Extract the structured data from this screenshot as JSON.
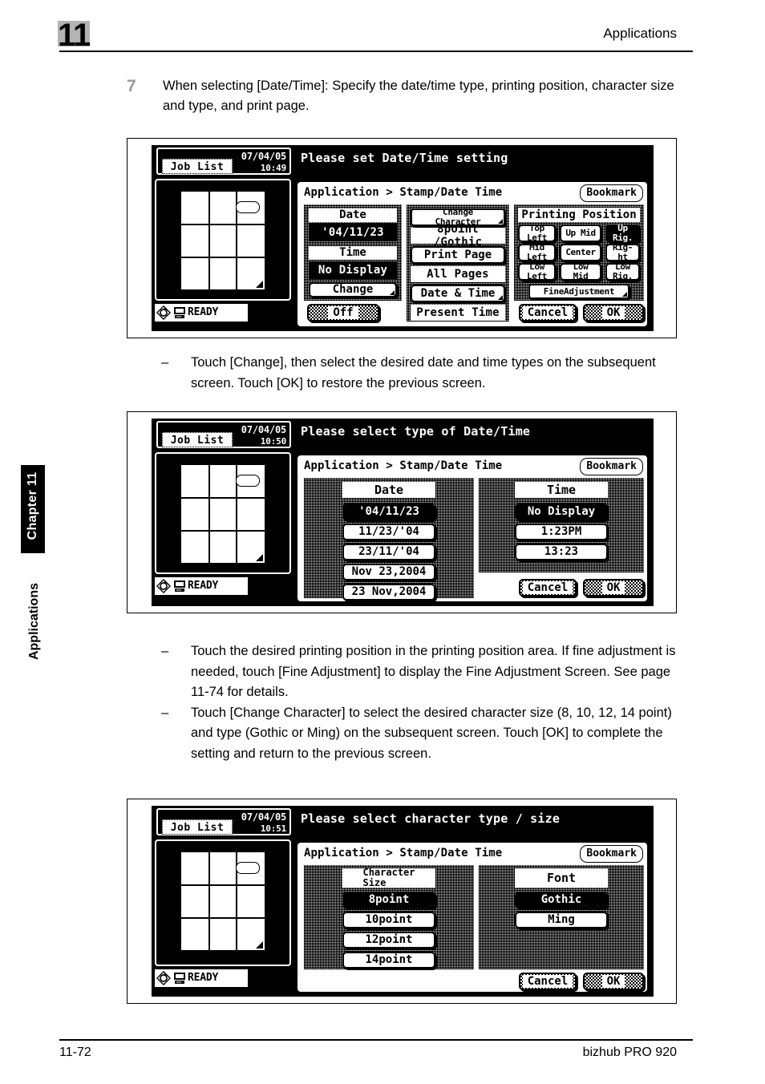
{
  "header": {
    "chapter_number": "11",
    "title": "Applications"
  },
  "side_tab": {
    "chapter_label": "Chapter 11",
    "subject_label": "Applications"
  },
  "footer": {
    "page_number": "11-72",
    "product": "bizhub PRO 920"
  },
  "step": {
    "number": "7",
    "text": "When selecting [Date/Time]: Specify the date/time type, printing position, character size and type, and print page."
  },
  "bullets_1": [
    "Touch [Change], then select the desired date and time types on the subsequent screen. Touch [OK] to restore the previous screen."
  ],
  "bullets_2": [
    "Touch the desired printing position in the printing position area. If fine adjustment is needed, touch [Fine Adjustment] to display the Fine Adjustment Screen. See page 11-74 for details.",
    "Touch [Change Character] to select the desired character size (8, 10, 12, 14 point) and type (Gothic or Ming) on the subsequent screen. Touch [OK] to complete the setting and return to the previous screen."
  ],
  "screen1": {
    "job_list_label": "Job List",
    "date": "07/04/05",
    "time": "10:49",
    "message": "Please set Date/Time setting",
    "breadcrumb": "Application > Stamp/Date Time",
    "bookmark_label": "Bookmark",
    "status": "READY",
    "left_group": {
      "date_title": "Date",
      "date_value": "'04/11/23",
      "time_title": "Time",
      "time_value": "No Display",
      "change_label": "Change",
      "off_label": "Off"
    },
    "mid_group": {
      "change_character_label": "Change\nCharacter",
      "change_character_value": "8point /Gothic",
      "print_page_label": "Print Page",
      "print_page_value": "All Pages",
      "date_time_label": "Date & Time",
      "date_time_value": "Present Time"
    },
    "position_group": {
      "title": "Printing Position",
      "buttons": [
        {
          "label": "Top\nLeft",
          "selected": false
        },
        {
          "label": "Up Mid",
          "selected": false
        },
        {
          "label": "Up\nRig.",
          "selected": true
        },
        {
          "label": "Mid\nLeft",
          "selected": false
        },
        {
          "label": "Center",
          "selected": false
        },
        {
          "label": "Rig-\nht",
          "selected": false
        },
        {
          "label": "Low\nLeft",
          "selected": false
        },
        {
          "label": "Low\nMid",
          "selected": false
        },
        {
          "label": "Low\nRig.",
          "selected": false
        }
      ],
      "fine_adjustment_label": "FineAdjustment"
    },
    "cancel_label": "Cancel",
    "ok_label": "OK"
  },
  "screen2": {
    "job_list_label": "Job List",
    "date": "07/04/05",
    "time": "10:50",
    "message": "Please select type of Date/Time",
    "breadcrumb": "Application > Stamp/Date Time",
    "bookmark_label": "Bookmark",
    "status": "READY",
    "date_title": "Date",
    "date_options": [
      {
        "label": "'04/11/23",
        "selected": true
      },
      {
        "label": "11/23/'04",
        "selected": false
      },
      {
        "label": "23/11/'04",
        "selected": false
      },
      {
        "label": "Nov 23,2004",
        "selected": false
      },
      {
        "label": "23 Nov,2004",
        "selected": false
      }
    ],
    "time_title": "Time",
    "time_options": [
      {
        "label": "No Display",
        "selected": true
      },
      {
        "label": "1:23PM",
        "selected": false
      },
      {
        "label": "13:23",
        "selected": false
      }
    ],
    "cancel_label": "Cancel",
    "ok_label": "OK"
  },
  "screen3": {
    "job_list_label": "Job List",
    "date": "07/04/05",
    "time": "10:51",
    "message": "Please select character type / size",
    "breadcrumb": "Application > Stamp/Date Time",
    "bookmark_label": "Bookmark",
    "status": "READY",
    "size_title": "Character\nSize",
    "size_options": [
      {
        "label": "8point",
        "selected": true
      },
      {
        "label": "10point",
        "selected": false
      },
      {
        "label": "12point",
        "selected": false
      },
      {
        "label": "14point",
        "selected": false
      }
    ],
    "font_title": "Font",
    "font_options": [
      {
        "label": "Gothic",
        "selected": true
      },
      {
        "label": "Ming",
        "selected": false
      }
    ],
    "cancel_label": "Cancel",
    "ok_label": "OK"
  }
}
